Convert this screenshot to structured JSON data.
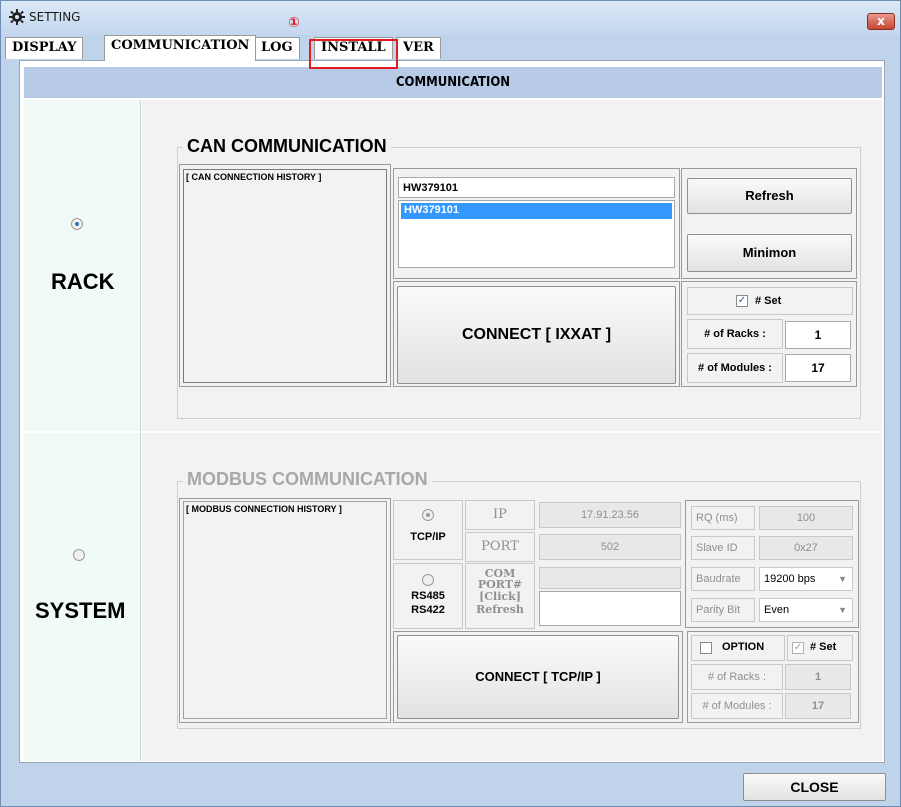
{
  "window": {
    "title": "SETTING",
    "close_symbol": "x"
  },
  "tabs": [
    {
      "label": "DISPLAY"
    },
    {
      "label": "COMMUNICATION"
    },
    {
      "label": "LOG"
    },
    {
      "label": "INSTALL"
    },
    {
      "label": "VER"
    }
  ],
  "annotation": {
    "marker": "①"
  },
  "header": {
    "title": "COMMUNICATION"
  },
  "rack": {
    "label": "RACK",
    "can": {
      "group_title": "CAN COMMUNICATION",
      "history_label": "[ CAN CONNECTION HISTORY ]",
      "device_input_value": "HW379101",
      "device_list": [
        "HW379101"
      ],
      "refresh_label": "Refresh",
      "minimon_label": "Minimon",
      "connect_label": "CONNECT [ IXXAT ]",
      "set_label": "# Set",
      "racks_label": "# of Racks :",
      "racks_value": "1",
      "modules_label": "# of Modules :",
      "modules_value": "17"
    }
  },
  "system": {
    "label": "SYSTEM",
    "modbus": {
      "group_title": "MODBUS COMMUNICATION",
      "history_label": "[ MODBUS CONNECTION HISTORY ]",
      "tcpip_label": "TCP/IP",
      "ip_label": "IP",
      "ip_value": "17.91.23.56",
      "port_label": "PORT",
      "port_value": "502",
      "rs_label_1": "RS485",
      "rs_label_2": "RS422",
      "com_label_1": "COM",
      "com_label_2": "PORT#",
      "com_label_3": "[Click]",
      "com_label_4": "Refresh",
      "rq_label": "RQ (ms)",
      "rq_value": "100",
      "slave_label": "Slave ID",
      "slave_value": "0x27",
      "baud_label": "Baudrate",
      "baud_value": "19200 bps",
      "parity_label": "Parity Bit",
      "parity_value": "Even",
      "option_label": "OPTION",
      "set_label": "# Set",
      "racks_label": "# of Racks :",
      "racks_value": "1",
      "modules_label": "# of Modules :",
      "modules_value": "17",
      "connect_label": "CONNECT [ TCP/IP ]"
    }
  },
  "footer": {
    "close_label": "CLOSE"
  }
}
